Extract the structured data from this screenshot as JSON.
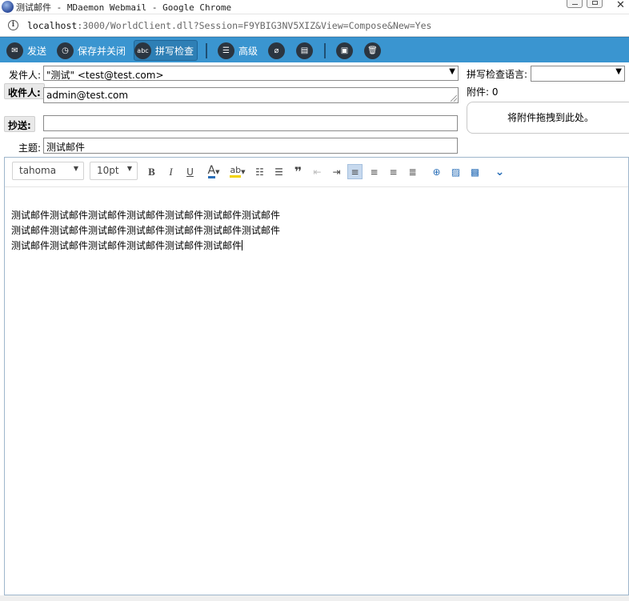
{
  "window": {
    "title": "测试邮件 - MDaemon Webmail - Google Chrome",
    "url_host": "localhost",
    "url_rest": ":3000/WorldClient.dll?Session=F9YBIG3NV5XIZ&View=Compose&New=Yes"
  },
  "toolbar": {
    "send_label": "发送",
    "save_close_label": "保存并关闭",
    "spellcheck_label": "拼写检查",
    "advanced_label": "高级"
  },
  "compose": {
    "from_label": "发件人:",
    "from_value": "\"测试\" <test@test.com>",
    "to_label": "收件人:",
    "to_value": "admin@test.com",
    "cc_label": "抄送:",
    "cc_value": "",
    "subject_label": "主题:",
    "subject_value": "测试邮件",
    "spell_lang_label": "拼写检查语言:",
    "spell_lang_value": "",
    "attachments_label": "附件: 0",
    "attach_drop_text": "将附件拖拽到此处。"
  },
  "editor": {
    "font_family": "tahoma",
    "font_size": "10pt",
    "body_lines": [
      "测试邮件测试邮件测试邮件测试邮件测试邮件测试邮件测试邮件",
      "测试邮件测试邮件测试邮件测试邮件测试邮件测试邮件测试邮件",
      "测试邮件测试邮件测试邮件测试邮件测试邮件测试邮件"
    ]
  },
  "colors": {
    "toolbar_bg": "#3a95d0",
    "active_align": "#c7d9ee"
  }
}
